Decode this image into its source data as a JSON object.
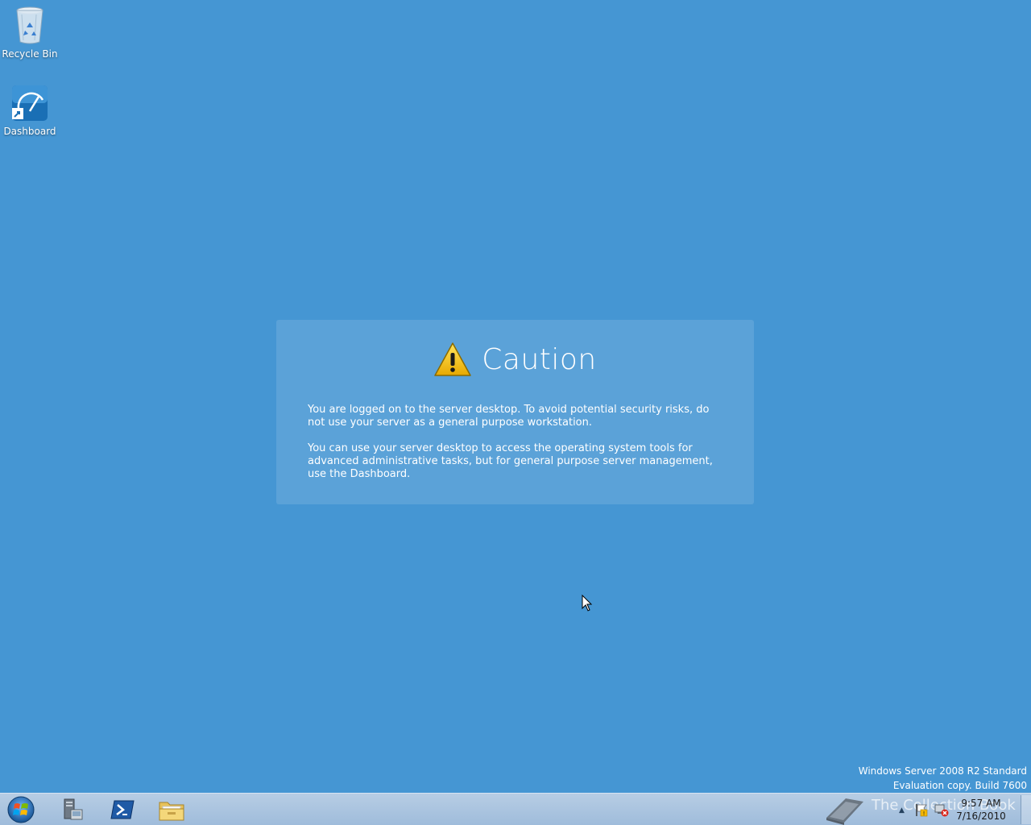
{
  "desktop": {
    "background_color": "#4596d3",
    "icons": [
      {
        "label": "Recycle Bin",
        "icon": "recycle-bin-icon"
      },
      {
        "label": "Dashboard",
        "icon": "dashboard-icon"
      }
    ]
  },
  "caution": {
    "icon": "warning-icon",
    "title": "Caution",
    "paragraph1": "You are logged on to the server desktop. To avoid potential security risks, do not use your server as a general purpose workstation.",
    "paragraph2": "You can use your server desktop to access the operating system tools for advanced administrative tasks, but for general purpose server management, use the Dashboard."
  },
  "watermark": {
    "line1": "Windows Server 2008 R2 Standard",
    "line2": "Evaluation copy. Build 7600"
  },
  "taskbar": {
    "start_icon": "windows-orb-icon",
    "pinned": [
      {
        "name": "Server Manager",
        "icon": "server-manager-icon"
      },
      {
        "name": "Windows PowerShell",
        "icon": "powershell-icon"
      },
      {
        "name": "Windows Explorer",
        "icon": "folder-icon"
      }
    ],
    "overlay_logo_text": "The Collection Book",
    "clock_time": "9:57 AM",
    "clock_date": "7/16/2010"
  }
}
